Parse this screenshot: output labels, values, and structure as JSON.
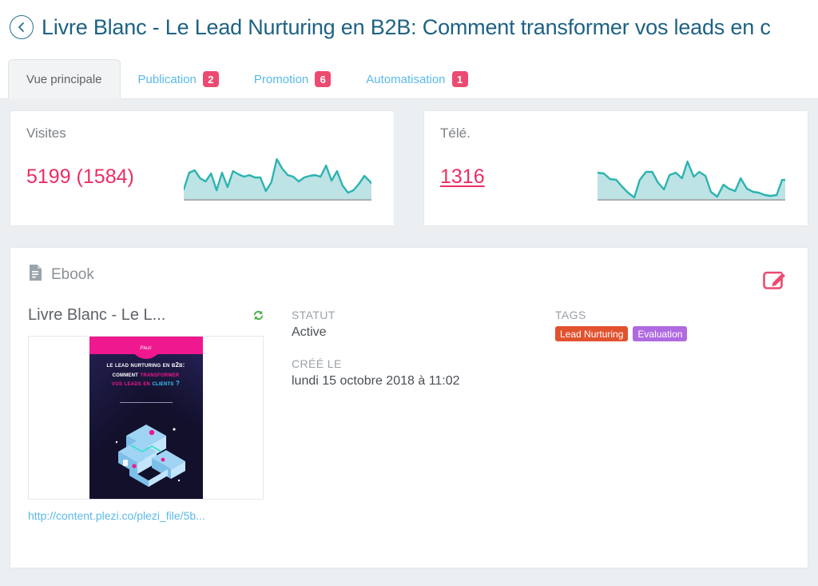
{
  "header": {
    "back_icon": "chevron-left-icon",
    "title": "Livre Blanc - Le Lead Nurturing en B2B: Comment transformer vos leads en c"
  },
  "tabs": [
    {
      "label": "Vue principale",
      "badge": "",
      "active": true
    },
    {
      "label": "Publication",
      "badge": "2",
      "active": false
    },
    {
      "label": "Promotion",
      "badge": "6",
      "active": false
    },
    {
      "label": "Automatisation",
      "badge": "1",
      "active": false
    }
  ],
  "stats": [
    {
      "label": "Visites",
      "value": "5199 (1584)",
      "is_link": false
    },
    {
      "label": "Télé.",
      "value": "1316",
      "is_link": true
    }
  ],
  "content_card": {
    "type_icon": "document-icon",
    "type_label": "Ebook",
    "edit_icon": "edit-pencil-icon",
    "asset_title": "Livre Blanc - Le L...",
    "sync_icon": "refresh-sync-icon",
    "asset_url": "http://content.plezi.co/plezi_file/5b...",
    "thumbnail": {
      "logo_text": "Plezi",
      "line1": "Le lead nurturing en B2B:",
      "line2_a": "Comment ",
      "line2_b": "transformer",
      "line3_a": "vos leads en ",
      "line3_b": "clients ?"
    },
    "fields": [
      {
        "label": "STATUT",
        "value": "Active"
      },
      {
        "label": "CRÉÉ LE",
        "value": "lundi 15 octobre 2018 à 11:02"
      }
    ],
    "tags_label": "TAGS",
    "tags": [
      {
        "label": "Lead Nurturing",
        "color": "#e2522e"
      },
      {
        "label": "Evaluation",
        "color": "#b06ae0"
      }
    ]
  },
  "colors": {
    "accent_pink": "#ec2e63",
    "badge_pink": "#ec4a71",
    "title_blue": "#1e6283",
    "link_blue": "#5bb9e8",
    "spark_stroke": "#2bb3b0",
    "spark_fill": "#bde3e5",
    "page_bg": "#eceff1"
  },
  "chart_data": [
    {
      "type": "area",
      "title": "Visites",
      "series": [
        {
          "name": "Visites",
          "values": [
            30,
            62,
            52,
            42,
            68,
            16,
            64,
            26,
            66,
            44,
            70,
            60,
            62,
            56,
            56,
            20,
            44,
            96,
            72,
            50,
            46,
            36,
            44,
            48,
            50,
            46,
            72,
            40,
            64,
            26,
            12,
            20,
            36,
            54,
            30
          ]
        }
      ],
      "ylim": [
        0,
        100
      ],
      "grid": false,
      "legend": "none"
    },
    {
      "type": "area",
      "title": "Télé.",
      "series": [
        {
          "name": "Téléchargements",
          "values": [
            62,
            58,
            44,
            44,
            30,
            12,
            4,
            40,
            62,
            62,
            38,
            22,
            56,
            60,
            46,
            92,
            52,
            62,
            54,
            20,
            6,
            34,
            26,
            22,
            54,
            26,
            18,
            16,
            10,
            8,
            10,
            44,
            44
          ]
        }
      ],
      "ylim": [
        0,
        100
      ],
      "grid": false,
      "legend": "none"
    }
  ]
}
